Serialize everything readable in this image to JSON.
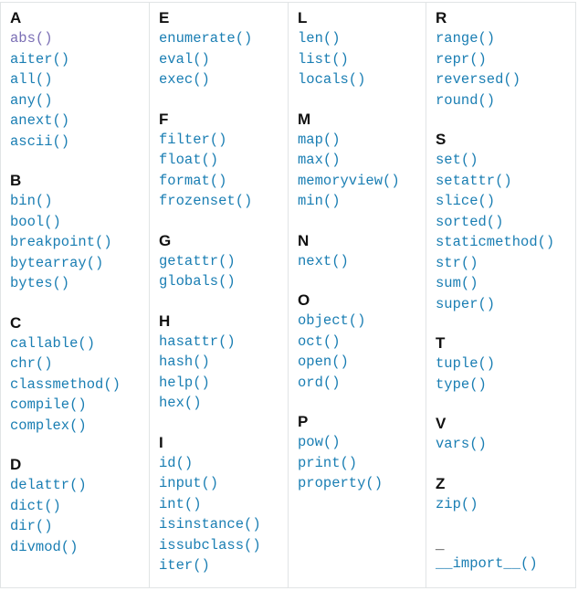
{
  "colors": {
    "link": "#1a7eb3",
    "visited": "#7b6fb5",
    "border": "#e1e4e5"
  },
  "columns": [
    {
      "groups": [
        {
          "letter": "A",
          "items": [
            "abs()",
            "aiter()",
            "all()",
            "any()",
            "anext()",
            "ascii()"
          ]
        },
        {
          "letter": "B",
          "items": [
            "bin()",
            "bool()",
            "breakpoint()",
            "bytearray()",
            "bytes()"
          ]
        },
        {
          "letter": "C",
          "items": [
            "callable()",
            "chr()",
            "classmethod()",
            "compile()",
            "complex()"
          ]
        },
        {
          "letter": "D",
          "items": [
            "delattr()",
            "dict()",
            "dir()",
            "divmod()"
          ]
        }
      ]
    },
    {
      "groups": [
        {
          "letter": "E",
          "items": [
            "enumerate()",
            "eval()",
            "exec()"
          ]
        },
        {
          "letter": "F",
          "items": [
            "filter()",
            "float()",
            "format()",
            "frozenset()"
          ]
        },
        {
          "letter": "G",
          "items": [
            "getattr()",
            "globals()"
          ]
        },
        {
          "letter": "H",
          "items": [
            "hasattr()",
            "hash()",
            "help()",
            "hex()"
          ]
        },
        {
          "letter": "I",
          "items": [
            "id()",
            "input()",
            "int()",
            "isinstance()",
            "issubclass()",
            "iter()"
          ]
        }
      ]
    },
    {
      "groups": [
        {
          "letter": "L",
          "items": [
            "len()",
            "list()",
            "locals()"
          ]
        },
        {
          "letter": "M",
          "items": [
            "map()",
            "max()",
            "memoryview()",
            "min()"
          ]
        },
        {
          "letter": "N",
          "items": [
            "next()"
          ]
        },
        {
          "letter": "O",
          "items": [
            "object()",
            "oct()",
            "open()",
            "ord()"
          ]
        },
        {
          "letter": "P",
          "items": [
            "pow()",
            "print()",
            "property()"
          ]
        }
      ]
    },
    {
      "groups": [
        {
          "letter": "R",
          "items": [
            "range()",
            "repr()",
            "reversed()",
            "round()"
          ]
        },
        {
          "letter": "S",
          "items": [
            "set()",
            "setattr()",
            "slice()",
            "sorted()",
            "staticmethod()",
            "str()",
            "sum()",
            "super()"
          ]
        },
        {
          "letter": "T",
          "items": [
            "tuple()",
            "type()"
          ]
        },
        {
          "letter": "V",
          "items": [
            "vars()"
          ]
        },
        {
          "letter": "Z",
          "items": [
            "zip()"
          ]
        },
        {
          "letter": "_",
          "items": [
            "__import__()"
          ]
        }
      ]
    }
  ]
}
